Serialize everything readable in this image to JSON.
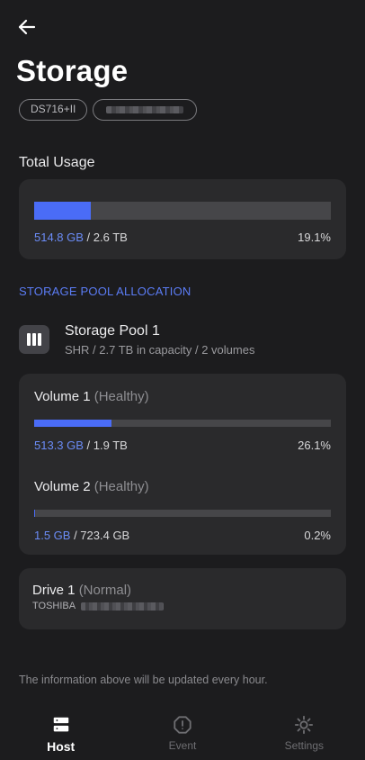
{
  "header": {
    "title": "Storage",
    "chips": [
      "DS716+II"
    ]
  },
  "total_usage": {
    "label": "Total Usage",
    "used": "514.8 GB",
    "total": " / 2.6 TB",
    "percent": "19.1%",
    "fraction": 0.191
  },
  "pool_allocation_label": "STORAGE POOL ALLOCATION",
  "pool": {
    "name": "Storage Pool 1",
    "description": "SHR / 2.7 TB in capacity / 2 volumes",
    "volumes": [
      {
        "name": "Volume 1",
        "status": "(Healthy)",
        "used": "513.3 GB",
        "total": " / 1.9 TB",
        "percent": "26.1%",
        "fraction": 0.261
      },
      {
        "name": "Volume 2",
        "status": "(Healthy)",
        "used": "1.5 GB",
        "total": " / 723.4 GB",
        "percent": "0.2%",
        "fraction": 0.002
      }
    ]
  },
  "drive": {
    "name": "Drive 1",
    "status": "(Normal)",
    "model": "TOSHIBA"
  },
  "footer_note": "The information above will be updated every hour.",
  "tabs": [
    {
      "label": "Host",
      "icon": "server-icon",
      "active": true
    },
    {
      "label": "Event",
      "icon": "alert-icon",
      "active": false
    },
    {
      "label": "Settings",
      "icon": "gear-icon",
      "active": false
    }
  ],
  "colors": {
    "accent": "#4a6cf7",
    "background": "#1c1c1e",
    "card": "#2a2a2c"
  }
}
